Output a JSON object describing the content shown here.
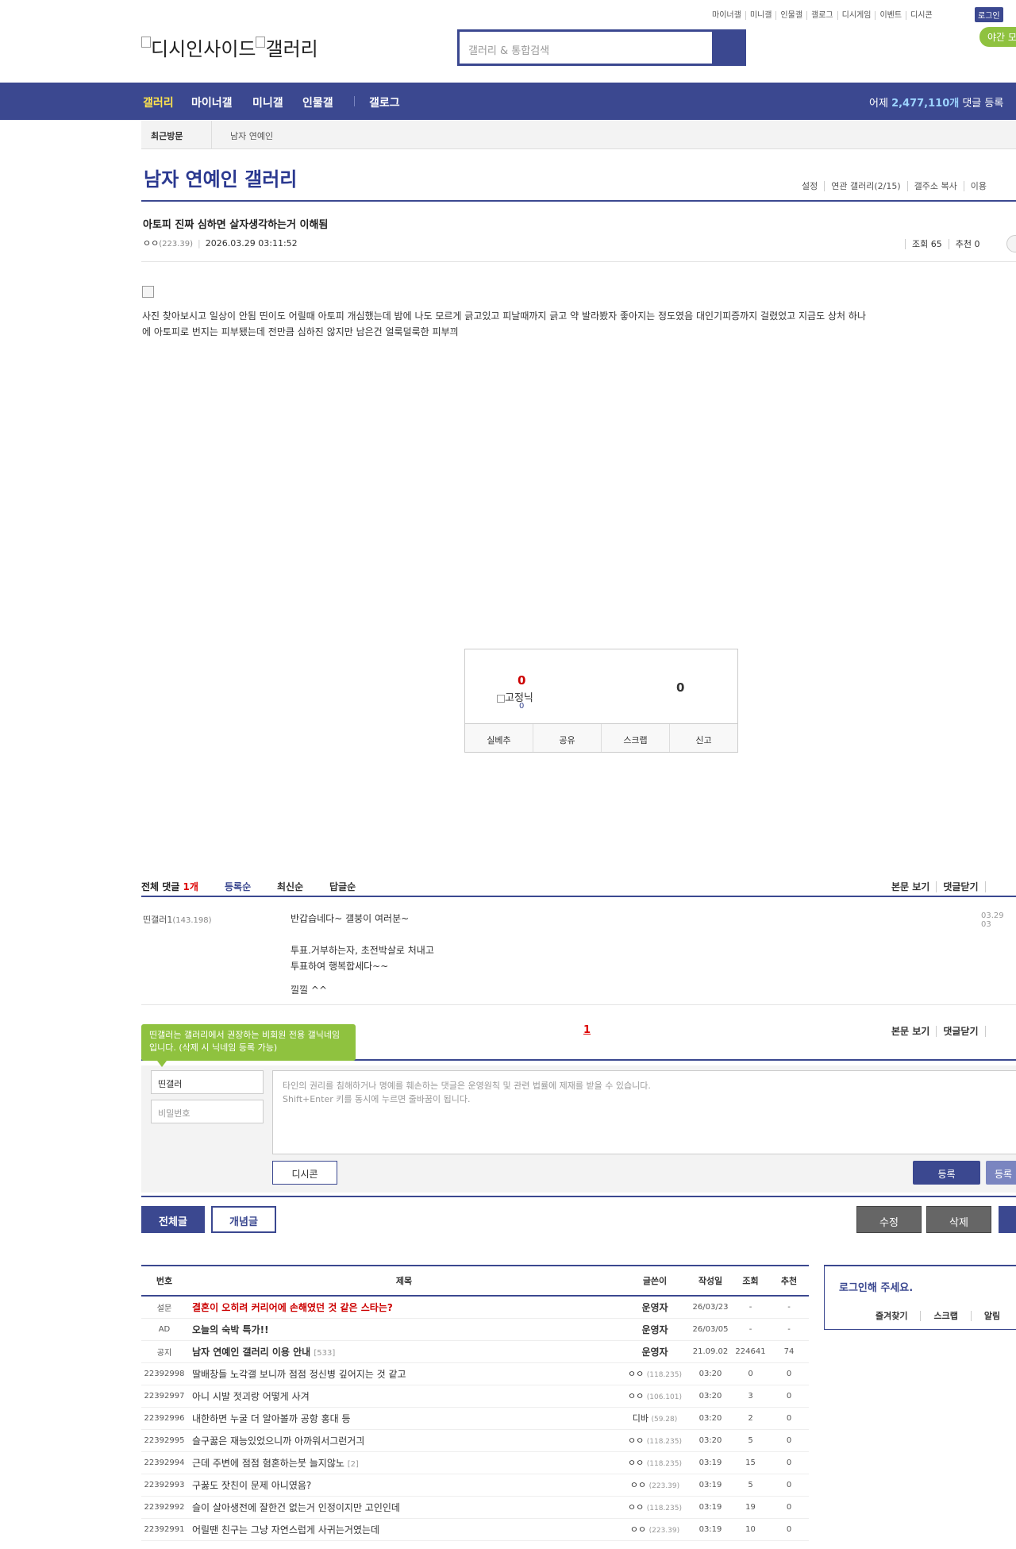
{
  "gnb": {
    "links": [
      "마이너갤",
      "미니갤",
      "인물갤",
      "갤로그",
      "디시게임",
      "이벤트",
      "디시콘"
    ],
    "login": "로그인",
    "night": "야간 모"
  },
  "logo": {
    "text": "디시인사이드",
    "sub": "갤러리"
  },
  "search": {
    "placeholder": "갤러리 & 통합검색"
  },
  "nav": {
    "items": [
      "갤러리",
      "마이너갤",
      "미니갤",
      "인물갤",
      "갤로그"
    ],
    "stat_prefix": "어제 ",
    "stat_value": "2,477,110개",
    "stat_suffix": " 댓글 등록"
  },
  "recent": {
    "label": "최근방문",
    "item": "남자 연예인"
  },
  "gallery": {
    "title": "남자 연예인 갤러리",
    "links": [
      "설정",
      "연관 갤러리(2/15)",
      "갤주소 복사",
      "이용"
    ]
  },
  "post": {
    "title": "아토피 진짜 심하면 살자생각하는거 이해됨",
    "writer": "ㅇㅇ",
    "ip": "(223.39)",
    "date": "2026.03.29 03:11:52",
    "views": "조회 65",
    "recommends": "추천 0",
    "body": "사진 찾아보시고 일상이 안됨 띤이도 어릴때 아토피 개심했는데 밤에 나도 모르게 긁고있고 피날때까지 긁고 약 발라봤자 좋아지는 정도였음 대인기피증까지 걸렸었고 지금도 상처 하나에 아토피로 번지는 피부됐는데 전만큼 심하진 않지만 남은건 얼룩덜룩한 피부끠"
  },
  "vote": {
    "up": "0",
    "down": "0",
    "fixed_nick": "고정닉",
    "fixed_count": "0",
    "buttons": [
      "실베추",
      "공유",
      "스크랩",
      "신고"
    ]
  },
  "comments": {
    "label": "전체 댓글 ",
    "count": "1개",
    "sort": [
      "등록순",
      "최신순",
      "답글순"
    ],
    "right": [
      "본문 보기",
      "댓글닫기"
    ],
    "items": [
      {
        "writer": "띤갤러1",
        "ip": "(143.198)",
        "lines": [
          "반갑습네다~ 갤붕이 여러분~",
          "투표.거부하는자, 초전박살로 처내고",
          "투표하여 행복합세다~~",
          "낄낄 ^^"
        ],
        "time": "03.29 03"
      }
    ],
    "page": "1"
  },
  "write": {
    "tooltip": "띤갤러는 갤러리에서 권장하는 비회원 전용 갤닉네임입니다. (삭제 시 닉네임 등록 가능)",
    "nick": "띤갤러",
    "password_placeholder": "비밀번호",
    "textarea_line1": "타인의 권리를 침해하거나 명예를 훼손하는 댓글은 운영원칙 및 관련 법률에 제재를 받을 수 있습니다.",
    "textarea_line2": "Shift+Enter 키를 동시에 누르면 줄바꿈이 됩니다.",
    "dccon": "디시콘",
    "register": "등록",
    "register2": "등록"
  },
  "buttons": {
    "all": "전체글",
    "concept": "개념글",
    "edit": "수정",
    "delete": "삭제"
  },
  "list": {
    "headers": [
      "번호",
      "제목",
      "글쓴이",
      "작성일",
      "조회",
      "추천"
    ],
    "rows": [
      {
        "no": "설문",
        "title": "결혼이 오히려 커리어에 손해였던 것 같은 스타는?",
        "reply": "",
        "writer": "운영자",
        "ip": "",
        "date": "26/03/23",
        "views": "-",
        "rec": "-",
        "type": "survey"
      },
      {
        "no": "AD",
        "title": "오늘의 숙박 특가!!",
        "reply": "",
        "writer": "운영자",
        "ip": "",
        "date": "26/03/05",
        "views": "-",
        "rec": "-",
        "type": "notice"
      },
      {
        "no": "공지",
        "title": "남자 연예인 갤러리 이용 안내",
        "reply": "[533]",
        "writer": "운영자",
        "ip": "",
        "date": "21.09.02",
        "views": "224641",
        "rec": "74",
        "type": "notice"
      },
      {
        "no": "22392998",
        "title": "딸배창들 노각갤 보니까 점점 정신병 깊어지는 것 같고",
        "reply": "",
        "writer": "ㅇㅇ",
        "ip": "(118.235)",
        "date": "03:20",
        "views": "0",
        "rec": "0",
        "type": "normal"
      },
      {
        "no": "22392997",
        "title": "아니 시발 젓괴랑 어떻게 사겨",
        "reply": "",
        "writer": "ㅇㅇ",
        "ip": "(106.101)",
        "date": "03:20",
        "views": "3",
        "rec": "0",
        "type": "normal"
      },
      {
        "no": "22392996",
        "title": "내한하면 누굴 더 알아볼까 공항 홍대 등",
        "reply": "",
        "writer": "디바",
        "ip": "(59.28)",
        "date": "03:20",
        "views": "2",
        "rec": "0",
        "type": "normal"
      },
      {
        "no": "22392995",
        "title": "슬구꿇은 재능있었으니까 아까워서그런거긔",
        "reply": "",
        "writer": "ㅇㅇ",
        "ip": "(118.235)",
        "date": "03:20",
        "views": "5",
        "rec": "0",
        "type": "normal"
      },
      {
        "no": "22392994",
        "title": "근데 주변에 점점 혐혼하는붓 늘지않노",
        "reply": "[2]",
        "writer": "ㅇㅇ",
        "ip": "(118.235)",
        "date": "03:19",
        "views": "15",
        "rec": "0",
        "type": "normal"
      },
      {
        "no": "22392993",
        "title": "구꿇도 잣친이 문제 아니였음?",
        "reply": "",
        "writer": "ㅇㅇ",
        "ip": "(223.39)",
        "date": "03:19",
        "views": "5",
        "rec": "0",
        "type": "normal"
      },
      {
        "no": "22392992",
        "title": "슬이 살아생전에 잘한건 없는거 인정이지만 고인인데",
        "reply": "",
        "writer": "ㅇㅇ",
        "ip": "(118.235)",
        "date": "03:19",
        "views": "19",
        "rec": "0",
        "type": "normal"
      },
      {
        "no": "22392991",
        "title": "어릴땐 친구는 그냥 자연스럽게 사귀는거였는데",
        "reply": "",
        "writer": "ㅇㅇ",
        "ip": "(223.39)",
        "date": "03:19",
        "views": "10",
        "rec": "0",
        "type": "normal"
      }
    ]
  },
  "side": {
    "title": "로그인해 주세요.",
    "links": [
      "즐겨찾기",
      "스크랩",
      "알림"
    ]
  }
}
